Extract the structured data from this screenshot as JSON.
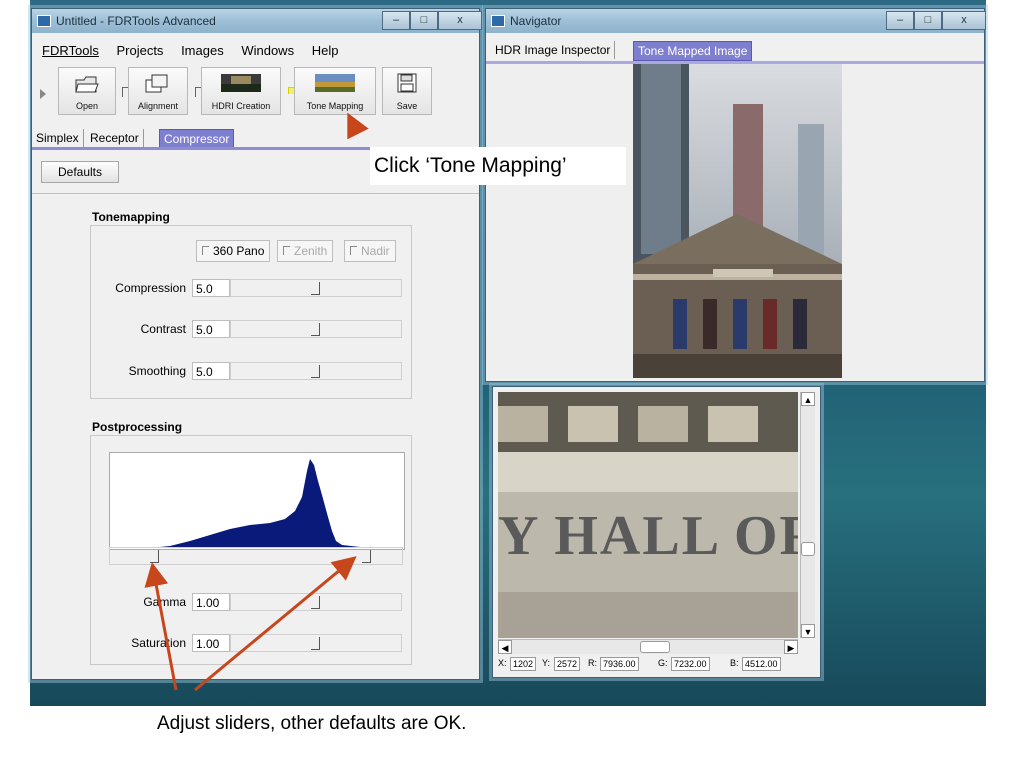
{
  "main_window": {
    "title": "Untitled - FDRTools Advanced",
    "menu": [
      "FDRTools",
      "Projects",
      "Images",
      "Windows",
      "Help"
    ],
    "toolbar": [
      "Open",
      "Alignment",
      "HDRI Creation",
      "Tone Mapping",
      "Save"
    ],
    "tabs": [
      "Simplex",
      "Receptor",
      "Compressor"
    ],
    "active_tab": "Compressor",
    "defaults_label": "Defaults",
    "tonemapping": {
      "heading": "Tonemapping",
      "options": [
        "360 Pano",
        "Zenith",
        "Nadir"
      ],
      "rows": [
        {
          "label": "Compression",
          "value": "5.0",
          "level": 0.5
        },
        {
          "label": "Contrast",
          "value": "5.0",
          "level": 0.5
        },
        {
          "label": "Smoothing",
          "value": "5.0",
          "level": 0.5
        }
      ]
    },
    "postprocessing": {
      "heading": "Postprocessing",
      "rows": [
        {
          "label": "Gamma",
          "value": "1.00",
          "level": 0.5
        },
        {
          "label": "Saturation",
          "value": "1.00",
          "level": 0.5
        }
      ],
      "histogram_color": "#0a1a7a"
    }
  },
  "navigator": {
    "title": "Navigator",
    "tabs": [
      "HDR Image Inspector",
      "Tone Mapped Image"
    ],
    "active_tab": "Tone Mapped Image"
  },
  "detail": {
    "image_text": "Y HALL OF",
    "status": {
      "x_label": "X:",
      "x": "1202",
      "y_label": "Y:",
      "y": "2572",
      "r_label": "R:",
      "r": "7936.00",
      "g_label": "G:",
      "g": "7232.00",
      "b_label": "B:",
      "b": "4512.00"
    }
  },
  "annotations": {
    "click_tone_mapping": "Click ‘Tone Mapping’",
    "adjust_sliders": "Adjust sliders, other defaults are OK."
  },
  "colors": {
    "arrow": "#c8461c",
    "tab_active": "#7f7fd0"
  }
}
